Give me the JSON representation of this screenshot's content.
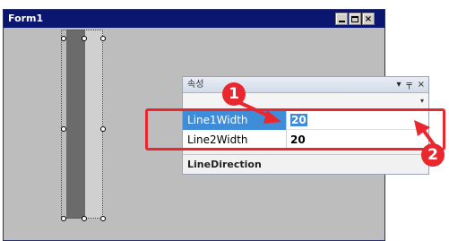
{
  "form": {
    "title": "Form1",
    "controls": {
      "minimize": "minimize",
      "maximize": "maximize",
      "close": "×"
    }
  },
  "properties_panel": {
    "title": "속성",
    "title_icons": [
      "▾",
      "╤",
      "×"
    ],
    "toolbar_caret": "▾",
    "rows": [
      {
        "name": "Line1Width",
        "value": "20",
        "selected": true
      },
      {
        "name": "Line2Width",
        "value": "20",
        "selected": false
      }
    ],
    "category": "LineDirection"
  },
  "annotations": {
    "badge1": "1",
    "badge2": "2",
    "accent_color": "#e8282e"
  },
  "colors": {
    "titlebar": "#0a1670",
    "selection": "#3f8cd8",
    "line1": "#6b6b6b",
    "line2": "#d0d0d0"
  }
}
